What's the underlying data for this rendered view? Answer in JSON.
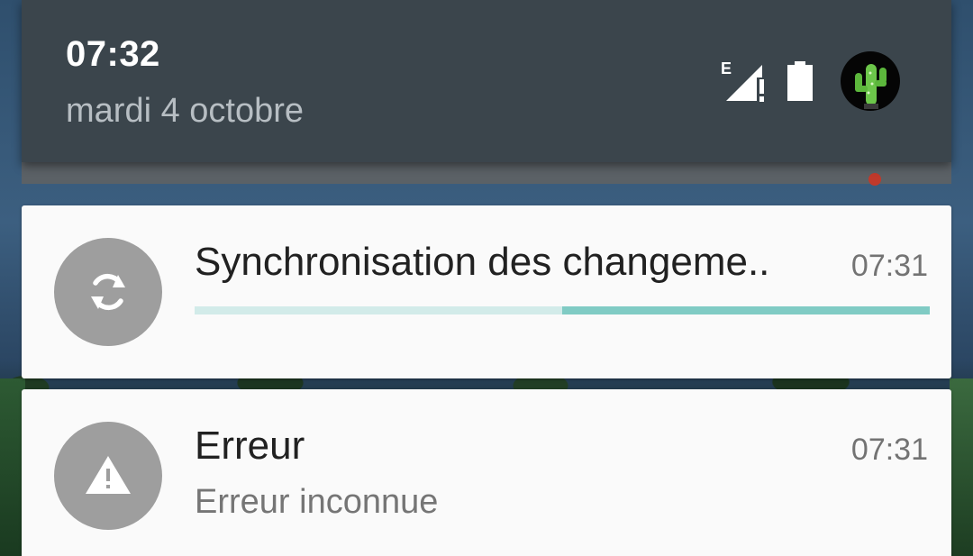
{
  "status_header": {
    "time": "07:32",
    "date": "mardi 4 octobre",
    "network_type": "E",
    "network_alert": "!",
    "icons": {
      "signal": "signal-edge-alert-icon",
      "battery": "battery-full-icon",
      "avatar": "cactus-avatar-icon"
    }
  },
  "notifications": [
    {
      "icon": "sync-icon",
      "title": "Synchronisation des changeme..",
      "time": "07:31",
      "progress": 0.5,
      "progress_color": "#80cbc4",
      "progress_track_color": "#d2ebe9"
    },
    {
      "icon": "warning-icon",
      "title": "Erreur",
      "time": "07:31",
      "text": "Erreur inconnue"
    }
  ],
  "colors": {
    "header_bg": "#3b454c",
    "card_bg": "#fafafa",
    "icon_circle": "#9e9e9e"
  }
}
